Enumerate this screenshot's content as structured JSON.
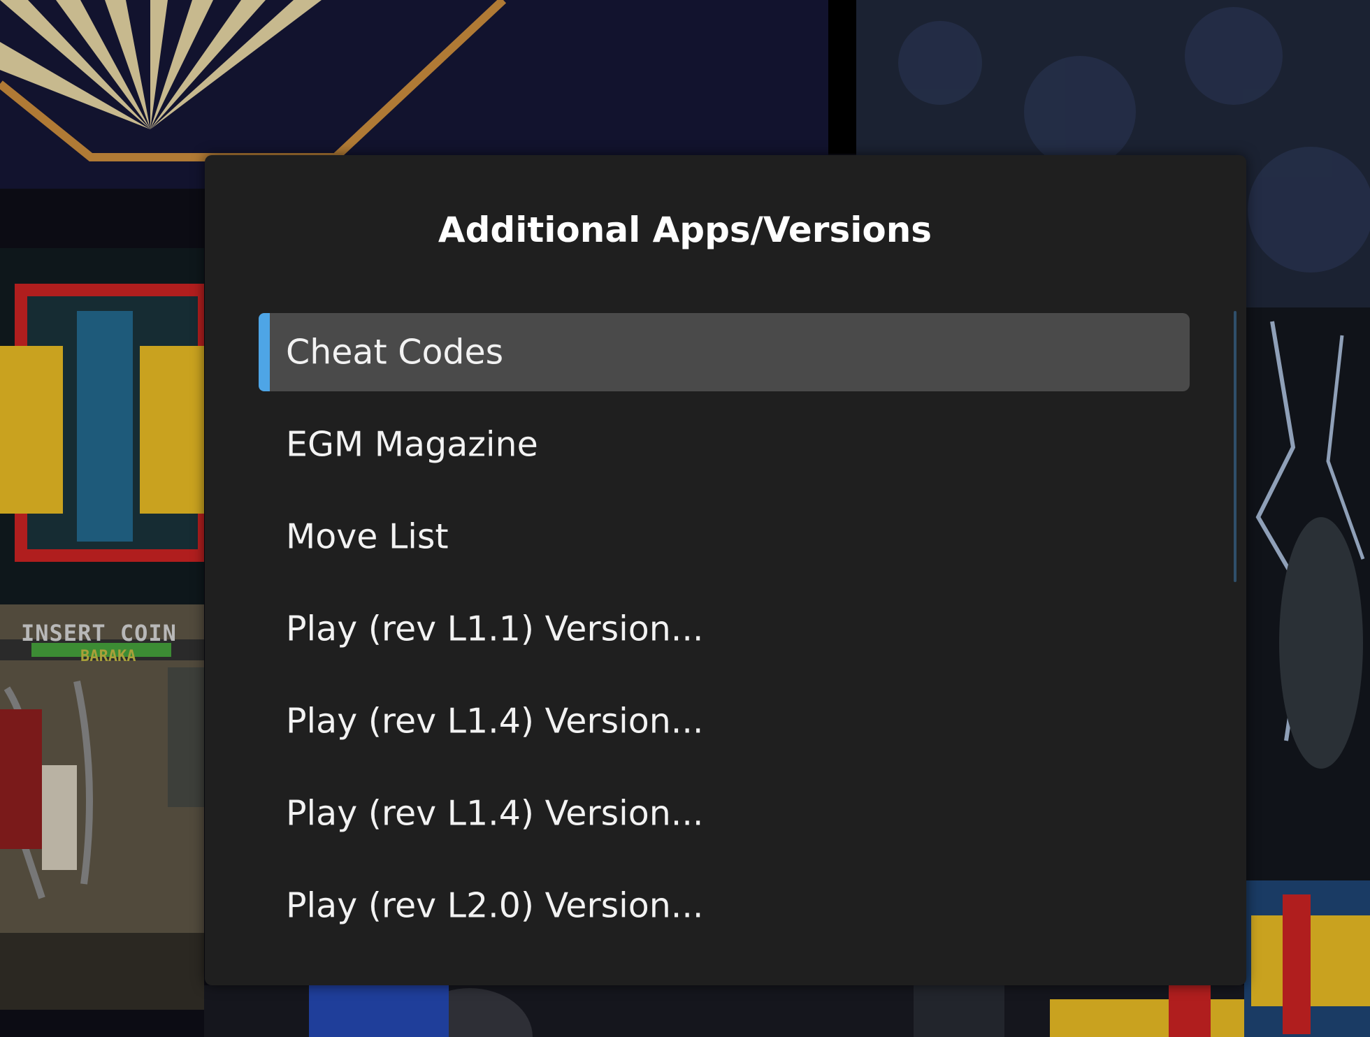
{
  "background": {
    "insert_coin_text": "INSERT COIN",
    "player_name_text": "BARAKA"
  },
  "modal": {
    "title": "Additional Apps/Versions",
    "items": [
      {
        "label": "Cheat Codes",
        "selected": true
      },
      {
        "label": "EGM Magazine",
        "selected": false
      },
      {
        "label": "Move List",
        "selected": false
      },
      {
        "label": "Play (rev L1.1) Version...",
        "selected": false
      },
      {
        "label": "Play (rev L1.4) Version...",
        "selected": false
      },
      {
        "label": "Play (rev L1.4) Version...",
        "selected": false
      },
      {
        "label": "Play (rev L2.0) Version...",
        "selected": false
      }
    ]
  },
  "colors": {
    "modal_background": "#1f1f1f",
    "selected_background": "#4a4a4a",
    "accent": "#4ea5e6",
    "text": "#f2f2f2"
  }
}
